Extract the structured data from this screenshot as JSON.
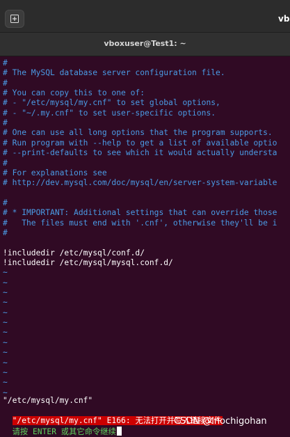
{
  "window": {
    "app_title": "vb",
    "title": "vboxuser@Test1: ~"
  },
  "icons": {
    "new_tab": "new-tab-icon"
  },
  "editor": {
    "lines": [
      "#",
      "# The MySQL database server configuration file.",
      "#",
      "# You can copy this to one of:",
      "# - \"/etc/mysql/my.cnf\" to set global options,",
      "# - \"~/.my.cnf\" to set user-specific options.",
      "#",
      "# One can use all long options that the program supports.",
      "# Run program with --help to get a list of available optio",
      "# --print-defaults to see which it would actually understa",
      "#",
      "# For explanations see",
      "# http://dev.mysql.com/doc/mysql/en/server-system-variable",
      "",
      "#",
      "# * IMPORTANT: Additional settings that can override those",
      "#   The files must end with '.cnf', otherwise they'll be i",
      "#",
      "",
      "!includedir /etc/mysql/conf.d/",
      "!includedir /etc/mysql/mysql.conf.d/"
    ],
    "tilde": "~",
    "tilde_count": 13
  },
  "status": {
    "filename": "\"/etc/mysql/my.cnf\"",
    "error": "\"/etc/mysql/my.cnf\" E166: 无法打开并写入链接文件",
    "prompt": "请按 ENTER 或其它命令继续"
  },
  "watermark": "CSDN @lnochigohan",
  "colors": {
    "background": "#300a24",
    "comment": "#4a9be5",
    "error_bg": "#cc0000",
    "prompt": "#5fd35f"
  }
}
